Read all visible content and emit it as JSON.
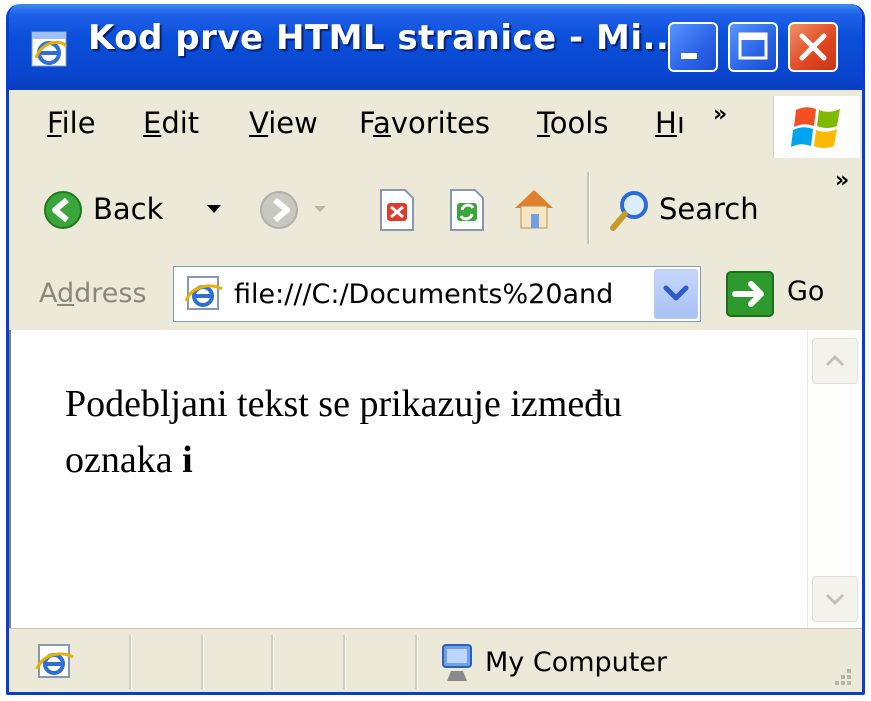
{
  "window": {
    "title": "Kod prve HTML stranice - Mi..."
  },
  "menu": {
    "items": [
      {
        "first": "F",
        "rest": "ile"
      },
      {
        "first": "E",
        "rest": "dit"
      },
      {
        "first": "V",
        "rest": "iew"
      },
      {
        "pre": "F",
        "first": "a",
        "rest": "vorites"
      },
      {
        "first": "T",
        "rest": "ools"
      },
      {
        "first": "H",
        "rest": "ı"
      }
    ],
    "overflow": "»"
  },
  "toolbar": {
    "back_label": "Back",
    "search_label": "Search",
    "overflow": "»"
  },
  "address": {
    "label_pre": "A",
    "label_mnem": "d",
    "label_post": "dress",
    "url": "file:///C:/Documents%20and",
    "go_label": "Go"
  },
  "content": {
    "text": "Podebljani tekst se prikazuje između",
    "text_line2_plain": "oznaka ",
    "text_line2_bold": "i"
  },
  "status": {
    "zone": "My Computer"
  },
  "colors": {
    "title_blue": "#0a4fd9",
    "close_red": "#e0451f",
    "chrome": "#ece9d8",
    "go_green": "#2e9a2e",
    "back_green": "#3aa53a"
  }
}
